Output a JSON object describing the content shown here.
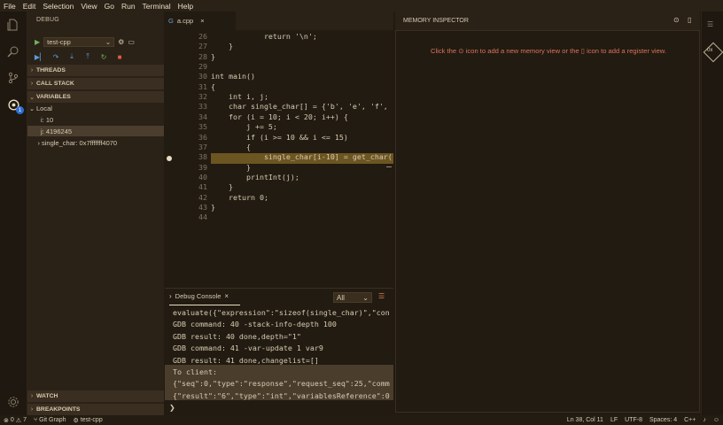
{
  "menubar": {
    "items": [
      "File",
      "Edit",
      "Selection",
      "View",
      "Go",
      "Run",
      "Terminal",
      "Help"
    ]
  },
  "sidebar": {
    "title": "DEBUG",
    "config": "test-cpp",
    "sections": {
      "threads": "THREADS",
      "call_stack": "CALL STACK",
      "variables": "VARIABLES",
      "watch": "WATCH",
      "breakpoints": "BREAKPOINTS"
    },
    "local": {
      "label": "Local",
      "vars": [
        {
          "name": "i",
          "value": "10"
        },
        {
          "name": "j",
          "value": "4196245"
        },
        {
          "name": "single_char",
          "value": "0x7fffffff4070"
        }
      ]
    },
    "activity_badge": "1"
  },
  "editor": {
    "tab": "a.cpp",
    "lines": [
      {
        "n": "26",
        "code": "            return '\\n';"
      },
      {
        "n": "27",
        "code": "    }"
      },
      {
        "n": "28",
        "code": "}"
      },
      {
        "n": "29",
        "code": ""
      },
      {
        "n": "30",
        "code": "int main()"
      },
      {
        "n": "31",
        "code": "{"
      },
      {
        "n": "32",
        "code": "    int i, j;"
      },
      {
        "n": "33",
        "code": "    char single_char[] = {'b', 'e', 'f',"
      },
      {
        "n": "34",
        "code": "    for (i = 10; i < 20; i++) {"
      },
      {
        "n": "35",
        "code": "        j += 5;"
      },
      {
        "n": "36",
        "code": "        if (i >= 10 && i <= 15)"
      },
      {
        "n": "37",
        "code": "        {"
      },
      {
        "n": "38",
        "code": "            single_char[i-10] = get_char("
      },
      {
        "n": "39",
        "code": "        }"
      },
      {
        "n": "40",
        "code": "        printInt(j);"
      },
      {
        "n": "41",
        "code": "    }"
      },
      {
        "n": "42",
        "code": "    return 0;"
      },
      {
        "n": "43",
        "code": "}"
      },
      {
        "n": "44",
        "code": ""
      }
    ]
  },
  "panel": {
    "tab": "Debug Console",
    "filter": "All",
    "lines": [
      "evaluate({\"expression\":\"sizeof(single_char)\",\"con",
      "GDB command: 40 -stack-info-depth 100",
      "GDB result: 40 done,depth=\"1\"",
      "GDB command: 41 -var-update 1 var9",
      "GDB result: 41 done,changelist=[]",
      "To client:",
      "{\"seq\":0,\"type\":\"response\",\"request_seq\":25,\"comm",
      "{\"result\":\"6\",\"type\":\"int\",\"variablesReference\":0"
    ],
    "prompt": "❯"
  },
  "memory": {
    "title": "MEMORY INSPECTOR",
    "msg_a": "Click the",
    "msg_b": "icon to add a new memory view or the",
    "msg_c": "icon to add a register view."
  },
  "status": {
    "errors": "0",
    "warnings": "7",
    "git": "Git Graph",
    "debug": "test-cpp",
    "position": "Ln 38, Col 11",
    "eol": "LF",
    "encoding": "UTF-8",
    "spaces": "Spaces: 4",
    "lang": "C++"
  },
  "colors": {
    "accent": "#dc7a52",
    "selection": "#6b5521",
    "badge": "#2f6fd6"
  }
}
